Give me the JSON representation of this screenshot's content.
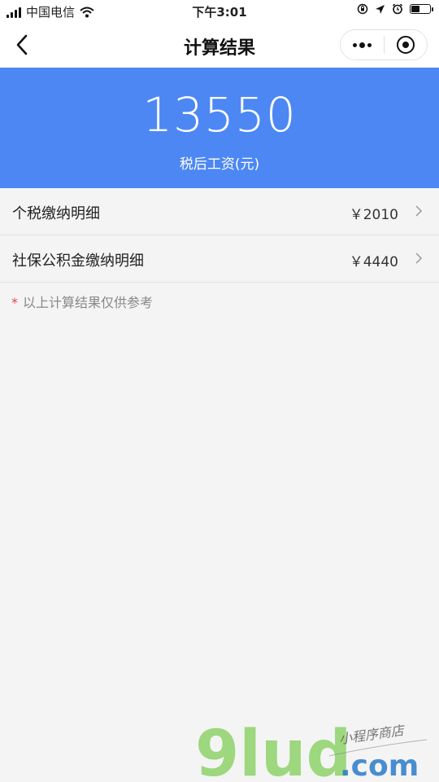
{
  "status_bar": {
    "carrier": "中国电信",
    "time": "下午3:01"
  },
  "nav": {
    "title": "计算结果"
  },
  "result": {
    "amount": "13550",
    "label": "税后工资(元)"
  },
  "details": [
    {
      "label": "个税缴纳明细",
      "value": "￥2010"
    },
    {
      "label": "社保公积金缴纳明细",
      "value": "￥4440"
    }
  ],
  "note": {
    "star": "*",
    "text": "以上计算结果仅供参考"
  },
  "watermark": {
    "logo_text": "9lud",
    "domain": ".com",
    "tagline": "小程序商店"
  },
  "colors": {
    "accent": "#4c87f4",
    "background": "#f4f4f4",
    "note_star": "#e0464b",
    "watermark_green": "#8fd26a",
    "watermark_blue": "#2b7cc9"
  },
  "icons": {
    "back": "chevron-left-icon",
    "more": "more-dots-icon",
    "close": "target-circle-icon",
    "row_arrow": "chevron-right-icon"
  }
}
